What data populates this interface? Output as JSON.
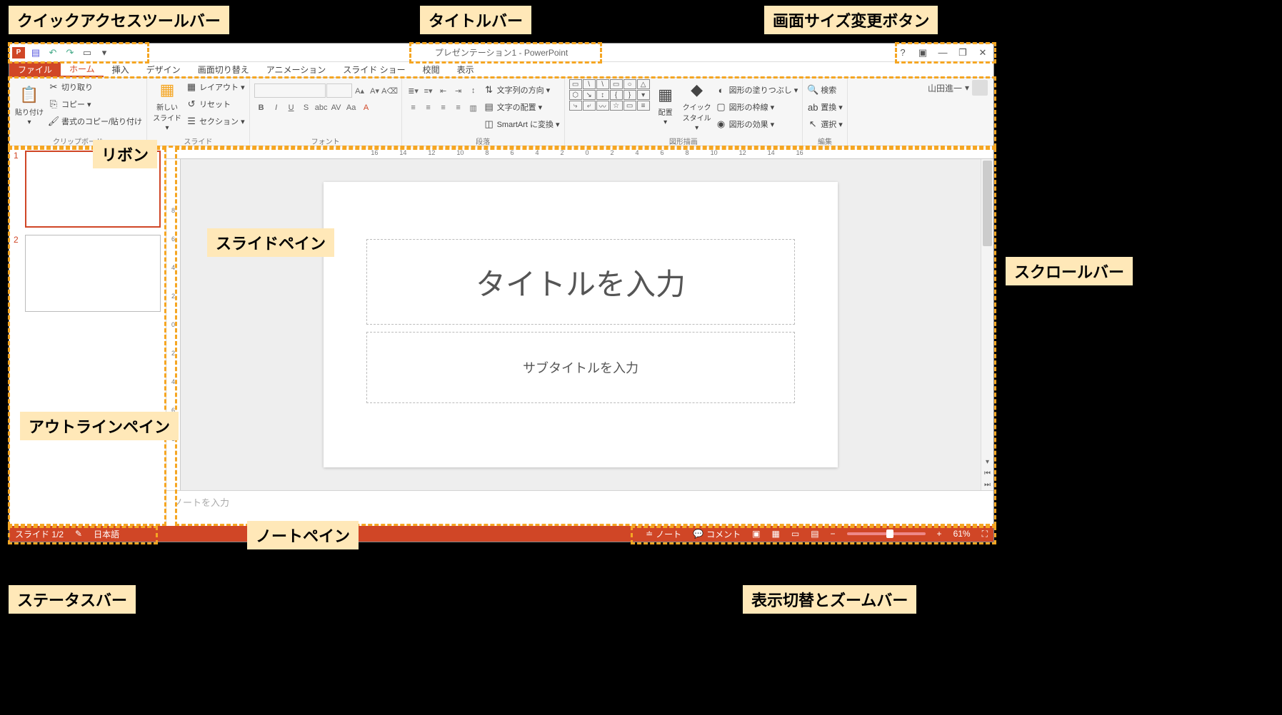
{
  "annotations": {
    "qat": "クイックアクセスツールバー",
    "titlebar": "タイトルバー",
    "winsize": "画面サイズ変更ボタン",
    "ribbon": "リボン",
    "slidepane": "スライドペイン",
    "outlinepane": "アウトラインペイン",
    "scrollbar": "スクロールバー",
    "notepane": "ノートペイン",
    "statusbar": "ステータスバー",
    "viewzoom": "表示切替とズームバー"
  },
  "title": "プレゼンテーション1 - PowerPoint",
  "user": "山田進一",
  "tabs": {
    "file": "ファイル",
    "home": "ホーム",
    "insert": "挿入",
    "design": "デザイン",
    "transitions": "画面切り替え",
    "animations": "アニメーション",
    "slideshow": "スライド ショー",
    "review": "校閲",
    "view": "表示"
  },
  "ribbon": {
    "clipboard": {
      "label": "クリップボード",
      "paste": "貼り付け",
      "cut": "切り取り",
      "copy": "コピー",
      "formatpainter": "書式のコピー/貼り付け"
    },
    "slides": {
      "label": "スライド",
      "newslide": "新しい\nスライド",
      "layout": "レイアウト",
      "reset": "リセット",
      "section": "セクション"
    },
    "font": {
      "label": "フォント"
    },
    "paragraph": {
      "label": "段落",
      "direction": "文字列の方向",
      "align": "文字の配置",
      "smartart": "SmartArt に変換"
    },
    "drawing": {
      "label": "図形描画",
      "arrange": "配置",
      "quickstyle": "クイック\nスタイル",
      "fill": "図形の塗りつぶし",
      "outline": "図形の枠線",
      "effects": "図形の効果"
    },
    "editing": {
      "label": "編集",
      "find": "検索",
      "replace": "置換",
      "select": "選択"
    }
  },
  "ruler": [
    "16",
    "14",
    "12",
    "10",
    "8",
    "6",
    "4",
    "2",
    "0",
    "2",
    "4",
    "6",
    "8",
    "10",
    "12",
    "14",
    "16"
  ],
  "rulerV": [
    "8",
    "6",
    "4",
    "2",
    "0",
    "2",
    "4",
    "6",
    "8"
  ],
  "slide": {
    "title": "タイトルを入力",
    "subtitle": "サブタイトルを入力"
  },
  "thumbs": [
    {
      "num": "1"
    },
    {
      "num": "2"
    }
  ],
  "notes_placeholder": "ノートを入力",
  "status": {
    "slide": "スライド 1/2",
    "lang": "日本語",
    "notes": "ノート",
    "comments": "コメント",
    "zoom": "61%"
  }
}
